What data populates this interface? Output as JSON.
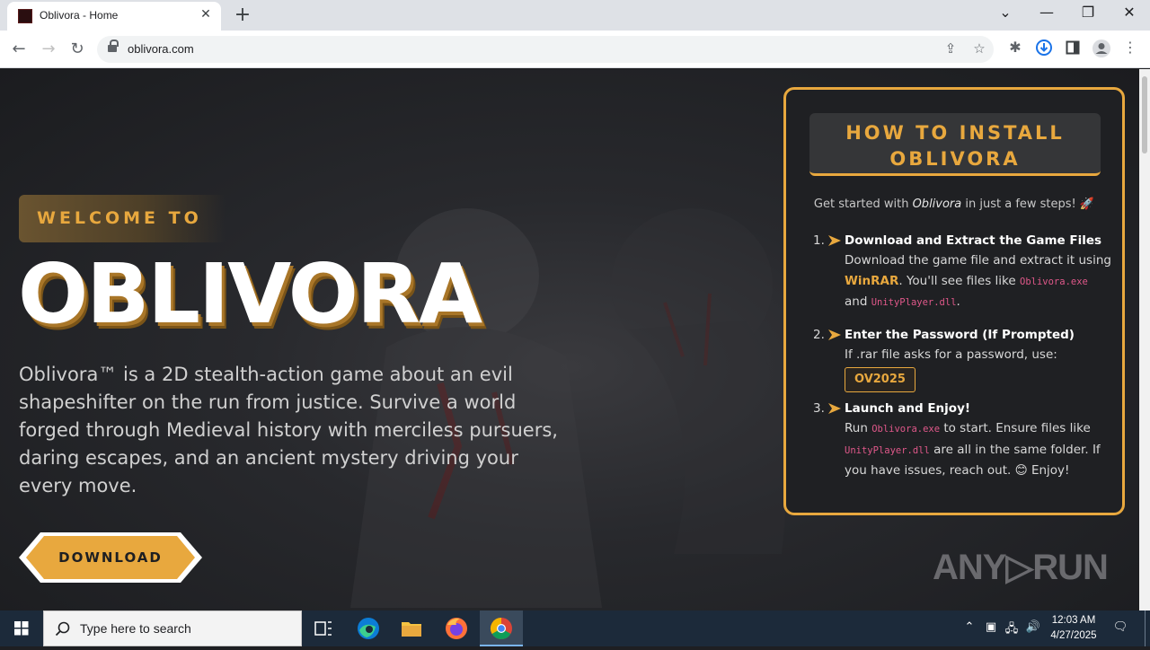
{
  "browser": {
    "tab_title": "Oblivora - Home",
    "tab_close": "✕",
    "new_tab": "+",
    "url": "oblivora.com",
    "controls": {
      "dropdown": "⌄",
      "minimize": "—",
      "restore": "❐",
      "close": "✕"
    },
    "nav": {
      "back": "←",
      "forward": "→",
      "reload": "↻"
    }
  },
  "hero": {
    "welcome": "WELCOME TO",
    "title": "OBLIVORA",
    "description": "Oblivora™ is a 2D stealth-action game about an evil shapeshifter on the run from justice. Survive a world forged through Medieval history with merciless pursuers, daring escapes, and an ancient mystery driving your every move.",
    "download_label": "DOWNLOAD"
  },
  "install": {
    "heading_line1": "HOW TO INSTALL",
    "heading_line2": "OBLIVORA",
    "subtitle_pre": "Get started with ",
    "subtitle_game": "Oblivora",
    "subtitle_post": " in just a few steps! 🚀",
    "steps": [
      {
        "num": "1.",
        "title": "Download and Extract the Game Files",
        "text1": "Download the game file and extract it using ",
        "tool": "WinRAR",
        "text2": ". You'll see files like ",
        "file1": "Oblivora.exe",
        "and": " and ",
        "file2": "UnityPlayer.dll",
        "end": "."
      },
      {
        "num": "2.",
        "title": "Enter the Password (If Prompted)",
        "text1": "If .rar file asks for a password, use:",
        "password": "OV2025"
      },
      {
        "num": "3.",
        "title": "Launch and Enjoy!",
        "text1": "Run ",
        "file1": "Oblivora.exe",
        "text2": " to start. Ensure files like ",
        "file2": "UnityPlayer.dll",
        "text3": " are all in the same folder. If you have issues, reach out. 😊 Enjoy!"
      }
    ]
  },
  "watermark": "ANY▷RUN",
  "taskbar": {
    "search_placeholder": "Type here to search",
    "time": "12:03 AM",
    "date": "4/27/2025"
  },
  "colors": {
    "accent": "#e8a83e",
    "code": "#e0588a",
    "panel_bg": "#1f2023"
  }
}
